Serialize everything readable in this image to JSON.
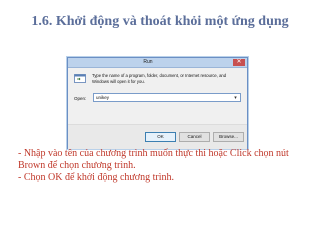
{
  "slide": {
    "title": "1.6. Khởi động và thoát khỏi một ứng dụng"
  },
  "run_dialog": {
    "title": "Run",
    "close_label": "✕",
    "description": "Type the name of a program, folder, document, or Internet resource, and Windows will open it for you.",
    "open_label": "Open:",
    "open_value": "unikey",
    "buttons": {
      "ok": "OK",
      "cancel": "Cancel",
      "browse": "Browse..."
    }
  },
  "bullets": [
    "- Nhập vào tên của chương trình muốn thực thi hoặc Click chọn nút Brown để chọn chương trình.",
    "- Chọn OK để khởi động chương trình."
  ],
  "colors": {
    "title": "#5b6e9a",
    "bullets": "#c0392b",
    "dialog_title_bar": "#bcd2ec",
    "close_button": "#c75050"
  }
}
